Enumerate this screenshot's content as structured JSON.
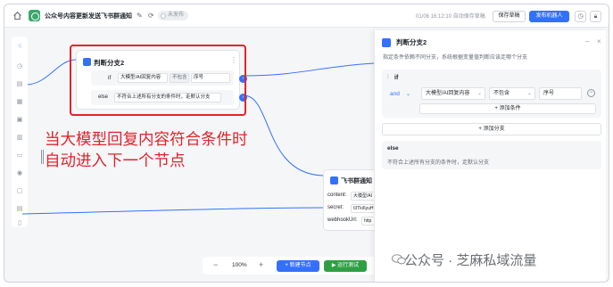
{
  "header": {
    "app_title": "公众号内容更新发送飞书群通知",
    "status_label": "未发布",
    "autosave_text": "01/06 16:12:10 自动保存草稿",
    "save_button": "保存草稿",
    "publish_button": "发布机器人"
  },
  "branch_node": {
    "title": "判断分支2",
    "if_label": "if",
    "condition": {
      "variable": "大模型/AI回复内容",
      "operator": "不包含",
      "value": "序号"
    },
    "else_label": "else",
    "else_text": "不符合上述所有分支的条件时，走默认分支"
  },
  "annotation": {
    "line1": "当大模型回复内容符合条件时",
    "line2": "自动进入下一个节点"
  },
  "feishu_node": {
    "title": "飞书群通知",
    "fields": [
      {
        "key": "content:",
        "value": "大模型/AI"
      },
      {
        "key": "secret:",
        "value": "t3Tki6yuHT"
      },
      {
        "key": "webhookUrl:",
        "value": "http"
      }
    ]
  },
  "bottom_toolbar": {
    "zoom_out": "−",
    "zoom": "100%",
    "zoom_in": "+",
    "new_node_button": "+ 新建节点",
    "run_button": "▶ 运行测试"
  },
  "panel": {
    "title": "判断分支2",
    "description": "指定条件依赖不同分支，系统根据变量值判断应该走哪个分支",
    "if_label": "if",
    "logic": "and",
    "condition": {
      "variable": "大模型/AI回复内容",
      "operator": "不包含",
      "value": "序号"
    },
    "add_condition": "+ 添加条件",
    "add_branch": "+ 添加分支",
    "else_title": "else",
    "else_desc": "不符合上述所有分支的条件时，走默认分支"
  },
  "watermark": "公众号 · 芝麻私域流量",
  "colors": {
    "accent": "#3370ff",
    "annotation": "#e0242c",
    "run": "#2ea043"
  }
}
